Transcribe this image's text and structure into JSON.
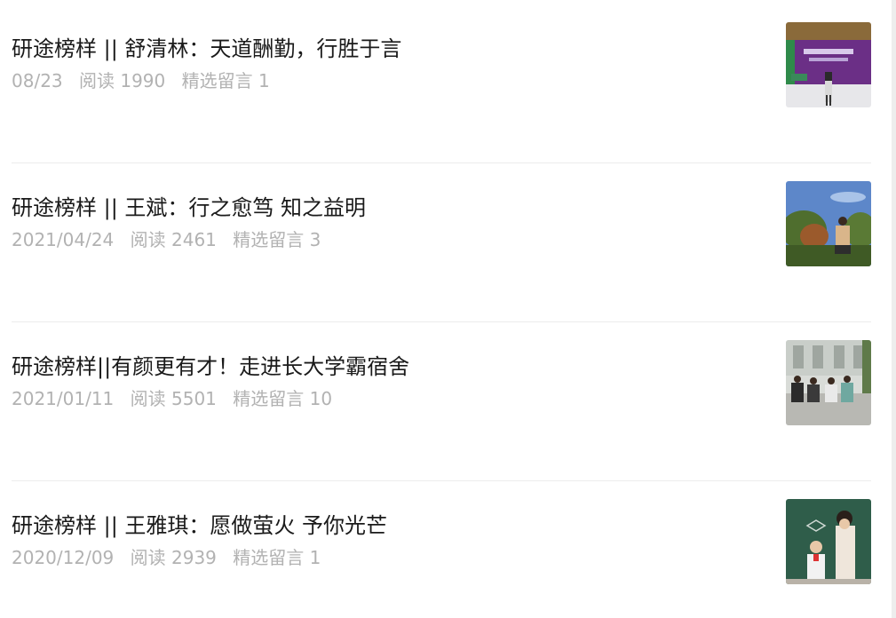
{
  "articles": [
    {
      "title": "研途榜样 || 舒清林：天道酬勤，行胜于言",
      "date": "08/23",
      "reads": "阅读 1990",
      "comments": "精选留言 1",
      "thumbnail": "award-ceremony-photo"
    },
    {
      "title": "研途榜样 || 王斌：行之愈笃 知之益明",
      "date": "2021/04/24",
      "reads": "阅读 2461",
      "comments": "精选留言 3",
      "thumbnail": "outdoor-portrait-photo"
    },
    {
      "title": "研途榜样||有颜更有才！走进长大学霸宿舍",
      "date": "2021/01/11",
      "reads": "阅读 5501",
      "comments": "精选留言 10",
      "thumbnail": "group-photo"
    },
    {
      "title": "研途榜样 || 王雅琪：愿做萤火 予你光芒",
      "date": "2020/12/09",
      "reads": "阅读 2939",
      "comments": "精选留言 1",
      "thumbnail": "classroom-photo"
    }
  ],
  "colors": {
    "title": "#1a1a1a",
    "meta": "#b2b2b2",
    "divider": "#ececec"
  }
}
